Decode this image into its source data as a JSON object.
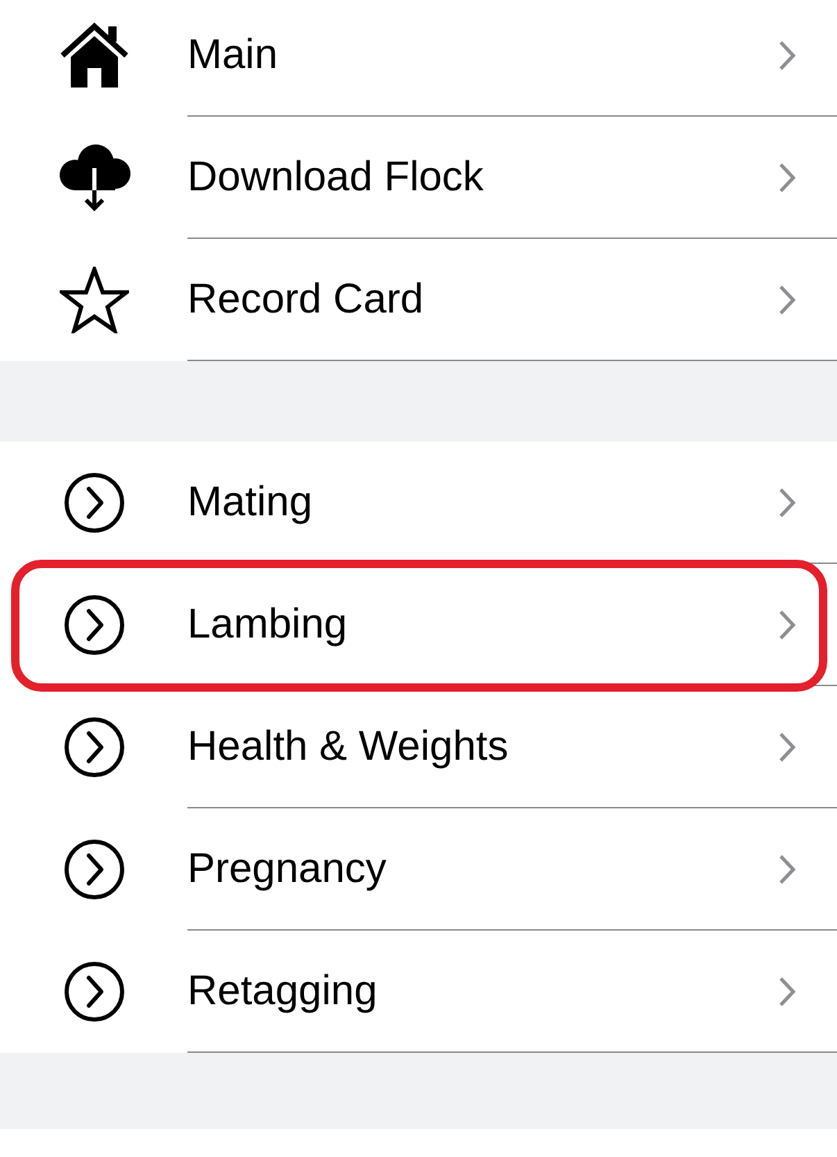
{
  "groups": [
    {
      "items": [
        {
          "label": "Main",
          "kind": "home",
          "highlighted": false
        },
        {
          "label": "Download Flock",
          "kind": "download",
          "highlighted": false
        },
        {
          "label": "Record Card",
          "kind": "star",
          "highlighted": false
        }
      ]
    },
    {
      "items": [
        {
          "label": "Mating",
          "kind": "circle",
          "highlighted": false
        },
        {
          "label": "Lambing",
          "kind": "circle",
          "highlighted": true
        },
        {
          "label": "Health & Weights",
          "kind": "circle",
          "highlighted": false
        },
        {
          "label": "Pregnancy",
          "kind": "circle",
          "highlighted": false
        },
        {
          "label": "Retagging",
          "kind": "circle",
          "highlighted": false
        }
      ]
    }
  ]
}
